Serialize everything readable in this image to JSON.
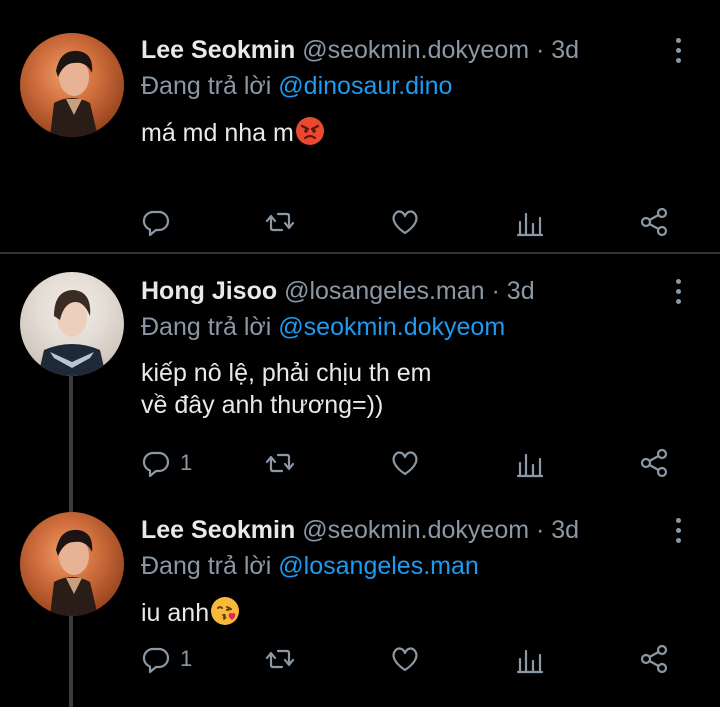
{
  "tweets": [
    {
      "name": "Lee Seokmin",
      "handle": "@seokmin.dokyeom",
      "dot": "·",
      "time": "3d",
      "reply_prefix": "Đang trả lời",
      "reply_to": "@dinosaur.dino",
      "text_lines": [
        "má md nha m"
      ],
      "emoji": "angry-face",
      "reply_count": ""
    },
    {
      "name": "Hong Jisoo",
      "handle": "@losangeles.man",
      "dot": "·",
      "time": "3d",
      "reply_prefix": "Đang trả lời",
      "reply_to": "@seokmin.dokyeom",
      "text_lines": [
        "kiếp nô lệ, phải chịu th em",
        "về đây anh thương=))"
      ],
      "emoji": "",
      "reply_count": "1"
    },
    {
      "name": "Lee Seokmin",
      "handle": "@seokmin.dokyeom",
      "dot": "·",
      "time": "3d",
      "reply_prefix": "Đang trả lời",
      "reply_to": "@losangeles.man",
      "text_lines": [
        "iu anh"
      ],
      "emoji": "face-blowing-kiss",
      "reply_count": "1"
    }
  ],
  "colors": {
    "background": "#000000",
    "text": "#e7e9ea",
    "secondary": "#8b98a5",
    "mention": "#1d9bf0",
    "divider": "#2f3336"
  },
  "icons": [
    "reply-icon",
    "retweet-icon",
    "like-icon",
    "analytics-icon",
    "share-icon",
    "more-icon"
  ]
}
